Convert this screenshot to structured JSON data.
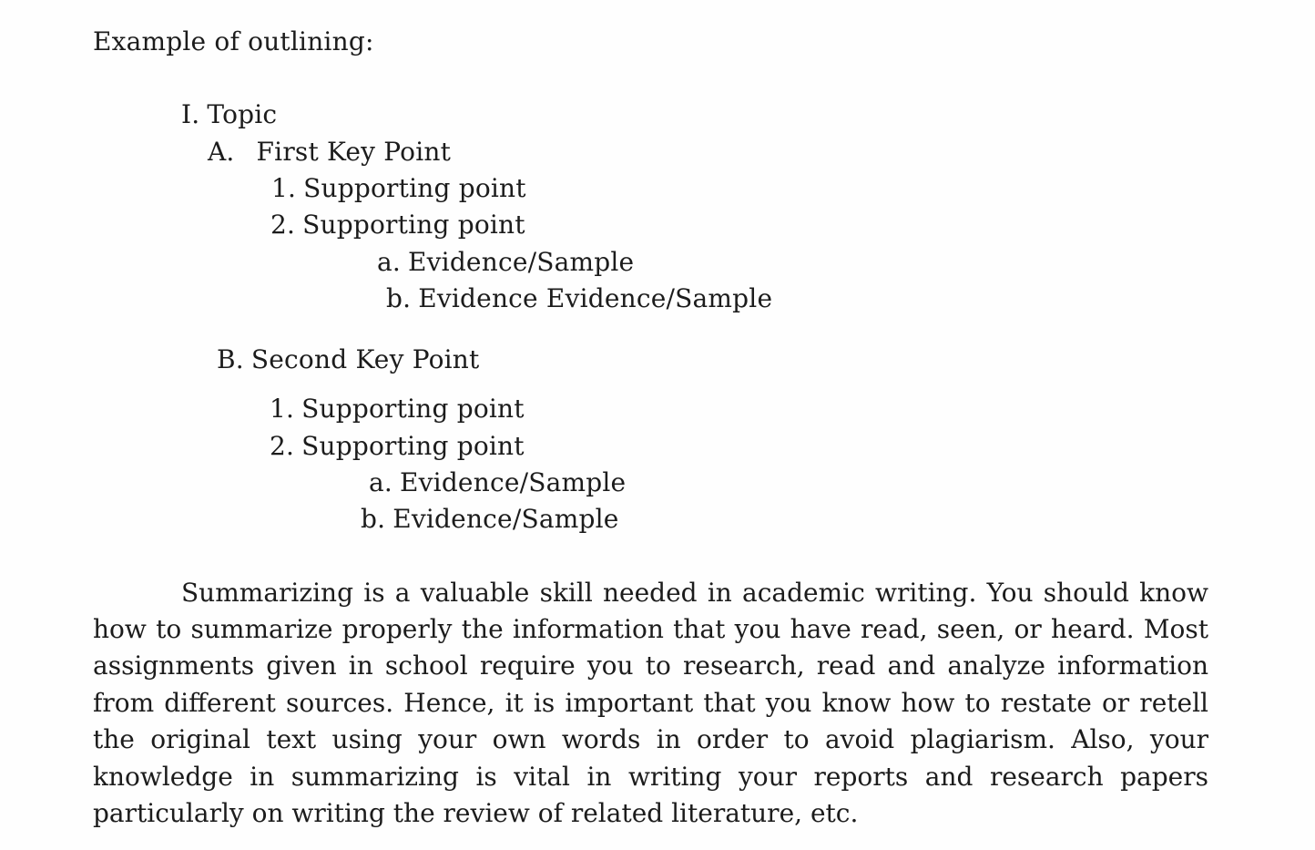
{
  "document": {
    "heading": "Example of outlining:",
    "outline": {
      "topic": {
        "marker": "I.",
        "text": "Topic"
      },
      "key_points": [
        {
          "marker": "A.",
          "text": "First Key Point",
          "supporting_points": [
            {
              "marker": "1.",
              "text": "Supporting point"
            },
            {
              "marker": "2.",
              "text": "Supporting point"
            }
          ],
          "evidence": [
            {
              "marker": "a.",
              "text": "Evidence/Sample"
            },
            {
              "marker": "b.",
              "text": "Evidence Evidence/Sample"
            }
          ]
        },
        {
          "marker": "B.",
          "text": "Second Key Point",
          "supporting_points": [
            {
              "marker": "1.",
              "text": "Supporting point"
            },
            {
              "marker": "2.",
              "text": "Supporting point"
            }
          ],
          "evidence": [
            {
              "marker": "a.",
              "text": "Evidence/Sample"
            },
            {
              "marker": "b.",
              "text": "Evidence/Sample"
            }
          ]
        }
      ]
    },
    "paragraph_lines": [
      "Summarizing is a valuable skill needed in academic writing. You should know",
      "how to summarize properly the information that you have read, seen, or heard. Most",
      "assignments given in school require you to research, read and analyze information",
      "from different sources. Hence, it is important that you know how to restate or retell",
      "the original text using your own words in order to avoid plagiarism. Also, your",
      "knowledge in summarizing is vital in writing your reports and research papers",
      "particularly on writing the review of related literature, etc."
    ]
  }
}
